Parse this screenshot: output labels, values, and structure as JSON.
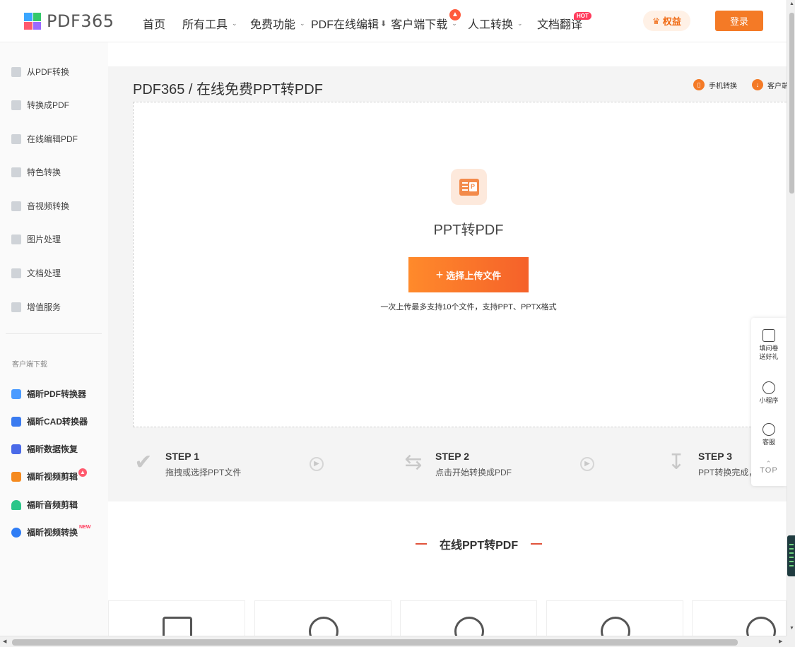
{
  "header": {
    "logo_text": "PDF365",
    "nav": [
      {
        "label": "首页"
      },
      {
        "label": "所有工具"
      },
      {
        "label": "免费功能"
      },
      {
        "label": "PDF在线编辑"
      },
      {
        "label": "客户端下载"
      },
      {
        "label": "人工转换"
      },
      {
        "label": "文档翻译"
      }
    ],
    "hot_badge": "HOT",
    "quanyi_label": "权益",
    "login_label": "登录"
  },
  "sidebar": {
    "items": [
      {
        "label": "从PDF转换"
      },
      {
        "label": "转换成PDF"
      },
      {
        "label": "在线编辑PDF"
      },
      {
        "label": "特色转换"
      },
      {
        "label": "音视频转换"
      },
      {
        "label": "图片处理"
      },
      {
        "label": "文档处理"
      },
      {
        "label": "增值服务"
      }
    ],
    "section_title": "客户端下载",
    "apps": [
      {
        "label": "福昕PDF转换器",
        "color": "#4a9bff"
      },
      {
        "label": "福昕CAD转换器",
        "color": "#3a7bf0"
      },
      {
        "label": "福昕数据恢复",
        "color": "#4a6ae8"
      },
      {
        "label": "福昕视频剪辑",
        "color": "#f58a1f"
      },
      {
        "label": "福昕音频剪辑",
        "color": "#2cc68a"
      },
      {
        "label": "福昕视频转换",
        "color": "#2f7df5"
      }
    ],
    "new_badge": "NEW"
  },
  "main": {
    "breadcrumb": "PDF365 / 在线免费PPT转PDF",
    "top_links": [
      {
        "label": "手机转换"
      },
      {
        "label": "客户端"
      }
    ],
    "tool_title": "PPT转PDF",
    "upload_button": "选择上传文件",
    "upload_hint": "一次上传最多支持10个文件，支持PPT、PPTX格式",
    "steps": [
      {
        "title": "STEP 1",
        "desc": "拖拽或选择PPT文件"
      },
      {
        "title": "STEP 2",
        "desc": "点击开始转换成PDF"
      },
      {
        "title": "STEP 3",
        "desc": "PPT转换完成，"
      }
    ],
    "section_title": "在线PPT转PDF"
  },
  "float_panel": {
    "items": [
      {
        "label": "填问卷送好礼"
      },
      {
        "label": "小程序"
      },
      {
        "label": "客服"
      }
    ],
    "top_label": "TOP"
  },
  "colors": {
    "accent": "#f47a26",
    "hot": "#ff3b5c"
  }
}
